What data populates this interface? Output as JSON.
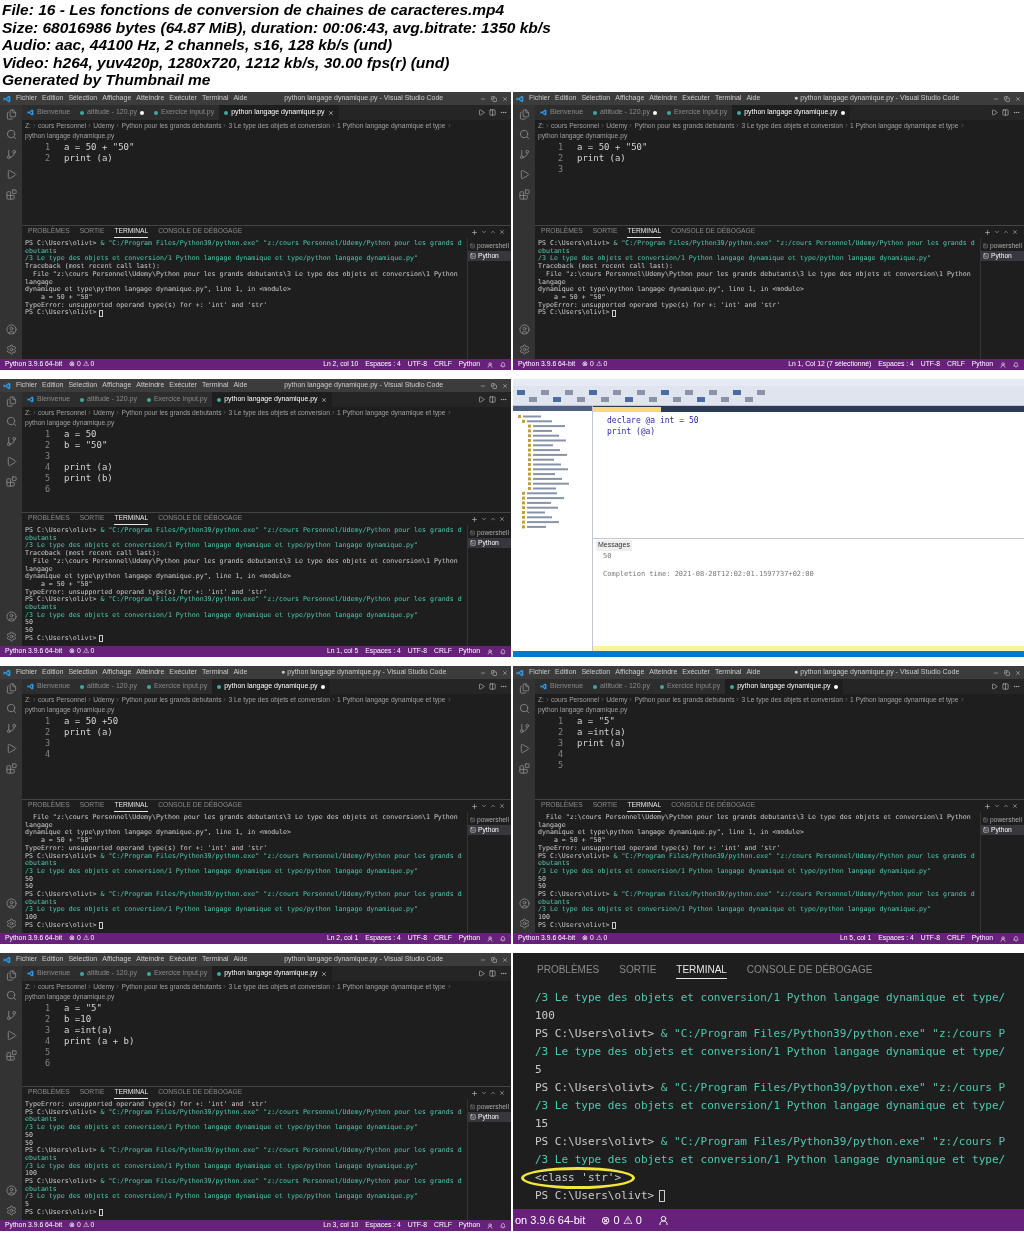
{
  "header": [
    "File: 16 - Les fonctions de conversion de chaines de caracteres.mp4",
    "Size: 68016986 bytes (64.87 MiB), duration: 00:06:43, avg.bitrate: 1350 kb/s",
    "Audio: aac, 44100 Hz, 2 channels, s16, 128 kb/s (und)",
    "Video: h264, yuv420p, 1280x720, 1212 kb/s, 30.00 fps(r) (und)",
    "Generated by Thumbnail me"
  ],
  "tiles": [
    {
      "kind": "vscode",
      "title": "python langage dynamique.py - Visual Studio Code",
      "menu": [
        "Fichier",
        "Edition",
        "Sélection",
        "Affichage",
        "Atteindre",
        "Exécuter",
        "Terminal",
        "Aide"
      ],
      "tabs": [
        {
          "kind": "welcome",
          "label": "Bienvenue",
          "selected": false,
          "modified": false
        },
        {
          "kind": "python",
          "label": "altitude - 120.py",
          "selected": false,
          "modified": true
        },
        {
          "kind": "python",
          "label": "Exercice input.py",
          "selected": false,
          "modified": false
        },
        {
          "kind": "python",
          "label": "python langage dynamique.py",
          "selected": true,
          "modified": false
        }
      ],
      "breadcrumb": [
        "Z:",
        "cours Personnel",
        "Udemy",
        "Python pour les grands debutants",
        "3 Le type des objets et conversion",
        "1 Python langage dynamique et type",
        "python langage dynamique.py"
      ],
      "code": [
        {
          "number": "1",
          "text": "a = 50 + \"50\""
        },
        {
          "number": "2",
          "text": "print (a)"
        }
      ],
      "panel_tabs": [
        {
          "label": "PROBLÈMES",
          "selected": false
        },
        {
          "label": "SORTIE",
          "selected": false
        },
        {
          "label": "TERMINAL",
          "selected": true
        },
        {
          "label": "CONSOLE DE DÉBOGAGE",
          "selected": false
        }
      ],
      "terminal": [
        {
          "kind": "command",
          "prompt": "PS C:\\Users\\olivt>",
          "text": "& \"C:/Program Files/Python39/python.exe\" \"z:/cours Personnel/Udemy/Python pour les grands debutants"
        },
        {
          "kind": "continuation",
          "text": "/3 Le type des objets et conversion/1 Python langage dynamique et type/python langage dynamique.py\""
        },
        {
          "kind": "output",
          "text": "Traceback (most recent call last):"
        },
        {
          "kind": "output",
          "text": "  File \"z:\\cours Personnel\\Udemy\\Python pour les grands debutants\\3 Le type des objets et conversion\\1 Python langage"
        },
        {
          "kind": "output",
          "text": "dynamique et type\\python langage dynamique.py\", line 1, in <module>"
        },
        {
          "kind": "output",
          "text": "    a = 50 + \"50\""
        },
        {
          "kind": "output",
          "text": "TypeError: unsupported operand type(s) for +: 'int' and 'str'"
        },
        {
          "kind": "prompt",
          "prompt": "PS C:\\Users\\olivt>"
        }
      ],
      "terminals": [
        {
          "label": "powershell",
          "selected": false
        },
        {
          "label": "Python",
          "selected": true
        }
      ],
      "status_left": [
        "Python 3.9.6 64-bit",
        "⊗ 0 ⚠ 0"
      ],
      "status_right": [
        "Ln 2, col 10",
        "Espaces : 4",
        "UTF-8",
        "CRLF",
        "Python"
      ]
    },
    {
      "kind": "vscode",
      "title": "● python langage dynamique.py - Visual Studio Code",
      "menu": [
        "Fichier",
        "Edition",
        "Sélection",
        "Affichage",
        "Atteindre",
        "Exécuter",
        "Terminal",
        "Aide"
      ],
      "tabs": [
        {
          "kind": "welcome",
          "label": "Bienvenue",
          "selected": false,
          "modified": false
        },
        {
          "kind": "python",
          "label": "altitude - 120.py",
          "selected": false,
          "modified": true
        },
        {
          "kind": "python",
          "label": "Exercice input.py",
          "selected": false,
          "modified": false
        },
        {
          "kind": "python",
          "label": "python langage dynamique.py",
          "selected": true,
          "modified": true
        }
      ],
      "breadcrumb": [
        "Z:",
        "cours Personnel",
        "Udemy",
        "Python pour les grands debutants",
        "3 Le type des objets et conversion",
        "1 Python langage dynamique et type",
        "python langage dynamique.py"
      ],
      "code": [
        {
          "number": "1",
          "text": "a = 50 + \"50\""
        },
        {
          "number": "2",
          "text": "print (a)"
        },
        {
          "number": "3"
        }
      ],
      "panel_tabs": [
        {
          "label": "PROBLÈMES",
          "selected": false
        },
        {
          "label": "SORTIE",
          "selected": false
        },
        {
          "label": "TERMINAL",
          "selected": true
        },
        {
          "label": "CONSOLE DE DÉBOGAGE",
          "selected": false
        }
      ],
      "terminal": [
        {
          "kind": "command",
          "prompt": "PS C:\\Users\\olivt>",
          "text": "& \"C:/Program Files/Python39/python.exe\" \"z:/cours Personnel/Udemy/Python pour les grands debutants"
        },
        {
          "kind": "continuation",
          "text": "/3 Le type des objets et conversion/1 Python langage dynamique et type/python langage dynamique.py\""
        },
        {
          "kind": "output",
          "text": "Traceback (most recent call last):"
        },
        {
          "kind": "output",
          "text": "  File \"z:\\cours Personnel\\Udemy\\Python pour les grands debutants\\3 Le type des objets et conversion\\1 Python langage"
        },
        {
          "kind": "output",
          "text": "dynamique et type\\python langage dynamique.py\", line 1, in <module>"
        },
        {
          "kind": "output",
          "text": "    a = 50 + \"50\""
        },
        {
          "kind": "output",
          "text": "TypeError: unsupported operand type(s) for +: 'int' and 'str'"
        },
        {
          "kind": "prompt",
          "prompt": "PS C:\\Users\\olivt>"
        }
      ],
      "terminals": [
        {
          "label": "powershell",
          "selected": false
        },
        {
          "label": "Python",
          "selected": true
        }
      ],
      "status_left": [
        "Python 3.9.6 64-bit",
        "⊗ 0 ⚠ 0"
      ],
      "status_right": [
        "Ln 1, Col 12 (7 sélectionné)",
        "Espaces : 4",
        "UTF-8",
        "CRLF",
        "Python"
      ]
    },
    {
      "kind": "vscode",
      "title": "python langage dynamique.py - Visual Studio Code",
      "menu": [
        "Fichier",
        "Edition",
        "Sélection",
        "Affichage",
        "Atteindre",
        "Exécuter",
        "Terminal",
        "Aide"
      ],
      "tabs": [
        {
          "kind": "welcome",
          "label": "Bienvenue",
          "selected": false,
          "modified": false
        },
        {
          "kind": "python",
          "label": "altitude - 120.py",
          "selected": false,
          "modified": false
        },
        {
          "kind": "python",
          "label": "Exercice input.py",
          "selected": false,
          "modified": false
        },
        {
          "kind": "python",
          "label": "python langage dynamique.py",
          "selected": true,
          "modified": false
        }
      ],
      "breadcrumb": [
        "Z:",
        "cours Personnel",
        "Udemy",
        "Python pour les grands debutants",
        "3 Le type des objets et conversion",
        "1 Python langage dynamique et type",
        "python langage dynamique.py"
      ],
      "code": [
        {
          "number": "1",
          "text": "a = 50"
        },
        {
          "number": "2",
          "text": "b = \"50\""
        },
        {
          "number": "3"
        },
        {
          "number": "4",
          "text": "print (a)"
        },
        {
          "number": "5",
          "text": "print (b)"
        },
        {
          "number": "6"
        }
      ],
      "panel_tabs": [
        {
          "label": "PROBLÈMES",
          "selected": false
        },
        {
          "label": "SORTIE",
          "selected": false
        },
        {
          "label": "TERMINAL",
          "selected": true
        },
        {
          "label": "CONSOLE DE DÉBOGAGE",
          "selected": false
        }
      ],
      "terminal": [
        {
          "kind": "command",
          "prompt": "PS C:\\Users\\olivt>",
          "text": "& \"C:/Program Files/Python39/python.exe\" \"z:/cours Personnel/Udemy/Python pour les grands debutants"
        },
        {
          "kind": "continuation",
          "text": "/3 Le type des objets et conversion/1 Python langage dynamique et type/python langage dynamique.py\""
        },
        {
          "kind": "output",
          "text": "Traceback (most recent call last):"
        },
        {
          "kind": "output",
          "text": "  File \"z:\\cours Personnel\\Udemy\\Python pour les grands debutants\\3 Le type des objets et conversion\\1 Python langage"
        },
        {
          "kind": "output",
          "text": "dynamique et type\\python langage dynamique.py\", line 1, in <module>"
        },
        {
          "kind": "output",
          "text": "    a = 50 + \"50\""
        },
        {
          "kind": "output",
          "text": "TypeError: unsupported operand type(s) for +: 'int' and 'str'"
        },
        {
          "kind": "command",
          "prompt": "PS C:\\Users\\olivt>",
          "text": "& \"C:/Program Files/Python39/python.exe\" \"z:/cours Personnel/Udemy/Python pour les grands debutants"
        },
        {
          "kind": "continuation",
          "text": "/3 Le type des objets et conversion/1 Python langage dynamique et type/python langage dynamique.py\""
        },
        {
          "kind": "output",
          "text": "50"
        },
        {
          "kind": "output",
          "text": "50"
        },
        {
          "kind": "prompt",
          "prompt": "PS C:\\Users\\olivt>"
        }
      ],
      "terminals": [
        {
          "label": "powershell",
          "selected": false
        },
        {
          "label": "Python",
          "selected": true
        }
      ],
      "status_left": [
        "Python 3.9.6 64-bit",
        "⊗ 0 ⚠ 0"
      ],
      "status_right": [
        "Ln 1, col 5",
        "Espaces : 4",
        "UTF-8",
        "CRLF",
        "Python"
      ]
    },
    {
      "kind": "ssms",
      "code": [
        "declare @a int = 50",
        "print (@a)"
      ],
      "messages_tab": "Messages",
      "messages": [
        "50",
        "Completion time: 2021-08-28T12:02:01.1597737+02:00"
      ]
    },
    {
      "kind": "vscode",
      "title": "● python langage dynamique.py - Visual Studio Code",
      "menu": [
        "Fichier",
        "Edition",
        "Sélection",
        "Affichage",
        "Atteindre",
        "Exécuter",
        "Terminal",
        "Aide"
      ],
      "tabs": [
        {
          "kind": "welcome",
          "label": "Bienvenue",
          "selected": false,
          "modified": false
        },
        {
          "kind": "python",
          "label": "altitude - 120.py",
          "selected": false,
          "modified": false
        },
        {
          "kind": "python",
          "label": "Exercice input.py",
          "selected": false,
          "modified": false
        },
        {
          "kind": "python",
          "label": "python langage dynamique.py",
          "selected": true,
          "modified": true
        }
      ],
      "breadcrumb": [
        "Z:",
        "cours Personnel",
        "Udemy",
        "Python pour les grands debutants",
        "3 Le type des objets et conversion",
        "1 Python langage dynamique et type",
        "python langage dynamique.py"
      ],
      "code": [
        {
          "number": "1",
          "text": "a = 50 +50"
        },
        {
          "number": "2",
          "text": "print (a)"
        },
        {
          "number": "3"
        },
        {
          "number": "4"
        }
      ],
      "panel_tabs": [
        {
          "label": "PROBLÈMES",
          "selected": false
        },
        {
          "label": "SORTIE",
          "selected": false
        },
        {
          "label": "TERMINAL",
          "selected": true
        },
        {
          "label": "CONSOLE DE DÉBOGAGE",
          "selected": false
        }
      ],
      "terminal": [
        {
          "kind": "output",
          "text": "  File \"z:\\cours Personnel\\Udemy\\Python pour les grands debutants\\3 Le type des objets et conversion\\1 Python langage"
        },
        {
          "kind": "output",
          "text": "dynamique et type\\python langage dynamique.py\", line 1, in <module>"
        },
        {
          "kind": "output",
          "text": "    a = 50 + \"50\""
        },
        {
          "kind": "output",
          "text": "TypeError: unsupported operand type(s) for +: 'int' and 'str'"
        },
        {
          "kind": "command",
          "prompt": "PS C:\\Users\\olivt>",
          "text": "& \"C:/Program Files/Python39/python.exe\" \"z:/cours Personnel/Udemy/Python pour les grands debutants"
        },
        {
          "kind": "continuation",
          "text": "/3 Le type des objets et conversion/1 Python langage dynamique et type/python langage dynamique.py\""
        },
        {
          "kind": "output",
          "text": "50"
        },
        {
          "kind": "output",
          "text": "50"
        },
        {
          "kind": "command",
          "prompt": "PS C:\\Users\\olivt>",
          "text": "& \"C:/Program Files/Python39/python.exe\" \"z:/cours Personnel/Udemy/Python pour les grands debutants"
        },
        {
          "kind": "continuation",
          "text": "/3 Le type des objets et conversion/1 Python langage dynamique et type/python langage dynamique.py\""
        },
        {
          "kind": "output",
          "text": "100"
        },
        {
          "kind": "prompt",
          "prompt": "PS C:\\Users\\olivt>"
        }
      ],
      "terminals": [
        {
          "label": "powershell",
          "selected": false
        },
        {
          "label": "Python",
          "selected": true
        }
      ],
      "status_left": [
        "Python 3.9.6 64-bit",
        "⊗ 0 ⚠ 0"
      ],
      "status_right": [
        "Ln 2, col 1",
        "Espaces : 4",
        "UTF-8",
        "CRLF",
        "Python"
      ]
    },
    {
      "kind": "vscode",
      "title": "● python langage dynamique.py - Visual Studio Code",
      "menu": [
        "Fichier",
        "Edition",
        "Sélection",
        "Affichage",
        "Atteindre",
        "Exécuter",
        "Terminal",
        "Aide"
      ],
      "tabs": [
        {
          "kind": "welcome",
          "label": "Bienvenue",
          "selected": false,
          "modified": false
        },
        {
          "kind": "python",
          "label": "altitude - 120.py",
          "selected": false,
          "modified": false
        },
        {
          "kind": "python",
          "label": "Exercice input.py",
          "selected": false,
          "modified": false
        },
        {
          "kind": "python",
          "label": "python langage dynamique.py",
          "selected": true,
          "modified": true
        }
      ],
      "breadcrumb": [
        "Z:",
        "cours Personnel",
        "Udemy",
        "Python pour les grands debutants",
        "3 Le type des objets et conversion",
        "1 Python langage dynamique et type",
        "python langage dynamique.py"
      ],
      "code": [
        {
          "number": "1",
          "text": "a = \"5\""
        },
        {
          "number": "2",
          "text": "a =int(a)"
        },
        {
          "number": "3",
          "text": "print (a)"
        },
        {
          "number": "4"
        },
        {
          "number": "5"
        }
      ],
      "panel_tabs": [
        {
          "label": "PROBLÈMES",
          "selected": false
        },
        {
          "label": "SORTIE",
          "selected": false
        },
        {
          "label": "TERMINAL",
          "selected": true
        },
        {
          "label": "CONSOLE DE DÉBOGAGE",
          "selected": false
        }
      ],
      "terminal": [
        {
          "kind": "output",
          "text": "  File \"z:\\cours Personnel\\Udemy\\Python pour les grands debutants\\3 Le type des objets et conversion\\1 Python langage"
        },
        {
          "kind": "output",
          "text": "dynamique et type\\python langage dynamique.py\", line 1, in <module>"
        },
        {
          "kind": "output",
          "text": "    a = 50 + \"50\""
        },
        {
          "kind": "output",
          "text": "TypeError: unsupported operand type(s) for +: 'int' and 'str'"
        },
        {
          "kind": "command",
          "prompt": "PS C:\\Users\\olivt>",
          "text": "& \"C:/Program Files/Python39/python.exe\" \"z:/cours Personnel/Udemy/Python pour les grands debutants"
        },
        {
          "kind": "continuation",
          "text": "/3 Le type des objets et conversion/1 Python langage dynamique et type/python langage dynamique.py\""
        },
        {
          "kind": "output",
          "text": "50"
        },
        {
          "kind": "output",
          "text": "50"
        },
        {
          "kind": "command",
          "prompt": "PS C:\\Users\\olivt>",
          "text": "& \"C:/Program Files/Python39/python.exe\" \"z:/cours Personnel/Udemy/Python pour les grands debutants"
        },
        {
          "kind": "continuation",
          "text": "/3 Le type des objets et conversion/1 Python langage dynamique et type/python langage dynamique.py\""
        },
        {
          "kind": "output",
          "text": "100"
        },
        {
          "kind": "prompt",
          "prompt": "PS C:\\Users\\olivt>"
        }
      ],
      "terminals": [
        {
          "label": "powershell",
          "selected": false
        },
        {
          "label": "Python",
          "selected": true
        }
      ],
      "status_left": [
        "Python 3.9.6 64-bit",
        "⊗ 0 ⚠ 0"
      ],
      "status_right": [
        "Ln 5, col 1",
        "Espaces : 4",
        "UTF-8",
        "CRLF",
        "Python"
      ]
    },
    {
      "kind": "vscode",
      "title": "python langage dynamique.py - Visual Studio Code",
      "menu": [
        "Fichier",
        "Edition",
        "Sélection",
        "Affichage",
        "Atteindre",
        "Exécuter",
        "Terminal",
        "Aide"
      ],
      "tabs": [
        {
          "kind": "welcome",
          "label": "Bienvenue",
          "selected": false,
          "modified": false
        },
        {
          "kind": "python",
          "label": "altitude - 120.py",
          "selected": false,
          "modified": false
        },
        {
          "kind": "python",
          "label": "Exercice input.py",
          "selected": false,
          "modified": false
        },
        {
          "kind": "python",
          "label": "python langage dynamique.py",
          "selected": true,
          "modified": false
        }
      ],
      "breadcrumb": [
        "Z:",
        "cours Personnel",
        "Udemy",
        "Python pour les grands debutants",
        "3 Le type des objets et conversion",
        "1 Python langage dynamique et type",
        "python langage dynamique.py"
      ],
      "code": [
        {
          "number": "1",
          "text": "a = \"5\""
        },
        {
          "number": "2",
          "text": "b =10"
        },
        {
          "number": "3",
          "text": "a =int(a)"
        },
        {
          "number": "4",
          "text": "print (a + b)"
        },
        {
          "number": "5"
        },
        {
          "number": "6"
        }
      ],
      "panel_tabs": [
        {
          "label": "PROBLÈMES",
          "selected": false
        },
        {
          "label": "SORTIE",
          "selected": false
        },
        {
          "label": "TERMINAL",
          "selected": true
        },
        {
          "label": "CONSOLE DE DÉBOGAGE",
          "selected": false
        }
      ],
      "terminal": [
        {
          "kind": "output",
          "text": "TypeError: unsupported operand type(s) for +: 'int' and 'str'"
        },
        {
          "kind": "command",
          "prompt": "PS C:\\Users\\olivt>",
          "text": "& \"C:/Program Files/Python39/python.exe\" \"z:/cours Personnel/Udemy/Python pour les grands debutants"
        },
        {
          "kind": "continuation",
          "text": "/3 Le type des objets et conversion/1 Python langage dynamique et type/python langage dynamique.py\""
        },
        {
          "kind": "output",
          "text": "50"
        },
        {
          "kind": "output",
          "text": "50"
        },
        {
          "kind": "command",
          "prompt": "PS C:\\Users\\olivt>",
          "text": "& \"C:/Program Files/Python39/python.exe\" \"z:/cours Personnel/Udemy/Python pour les grands debutants"
        },
        {
          "kind": "continuation",
          "text": "/3 Le type des objets et conversion/1 Python langage dynamique et type/python langage dynamique.py\""
        },
        {
          "kind": "output",
          "text": "100"
        },
        {
          "kind": "command",
          "prompt": "PS C:\\Users\\olivt>",
          "text": "& \"C:/Program Files/Python39/python.exe\" \"z:/cours Personnel/Udemy/Python pour les grands debutants"
        },
        {
          "kind": "continuation",
          "text": "/3 Le type des objets et conversion/1 Python langage dynamique et type/python langage dynamique.py\""
        },
        {
          "kind": "output",
          "text": "5"
        },
        {
          "kind": "prompt",
          "prompt": "PS C:\\Users\\olivt>"
        }
      ],
      "terminals": [
        {
          "label": "powershell",
          "selected": false
        },
        {
          "label": "Python",
          "selected": true
        }
      ],
      "status_left": [
        "Python 3.9.6 64-bit",
        "⊗ 0 ⚠ 0"
      ],
      "status_right": [
        "Ln 3, col 10",
        "Espaces : 4",
        "UTF-8",
        "CRLF",
        "Python"
      ]
    },
    {
      "kind": "terminal_zoom",
      "panel_tabs": [
        {
          "label": "PROBLÈMES",
          "selected": false
        },
        {
          "label": "SORTIE",
          "selected": false
        },
        {
          "label": "TERMINAL",
          "selected": true
        },
        {
          "label": "CONSOLE DE DÉBOGAGE",
          "selected": false
        }
      ],
      "terminal": [
        {
          "kind": "continuation",
          "text": "/3 Le type des objets et conversion/1 Python langage dynamique et type/",
          "circled": false
        },
        {
          "kind": "output",
          "text": "100",
          "circled": false
        },
        {
          "kind": "command",
          "prompt": "PS C:\\Users\\olivt>",
          "text": "& \"C:/Program Files/Python39/python.exe\" \"z:/cours P",
          "circled": false
        },
        {
          "kind": "continuation",
          "text": "/3 Le type des objets et conversion/1 Python langage dynamique et type/",
          "circled": false
        },
        {
          "kind": "output",
          "text": "5",
          "circled": false
        },
        {
          "kind": "command",
          "prompt": "PS C:\\Users\\olivt>",
          "text": "& \"C:/Program Files/Python39/python.exe\" \"z:/cours P",
          "circled": false
        },
        {
          "kind": "continuation",
          "text": "/3 Le type des objets et conversion/1 Python langage dynamique et type/",
          "circled": false
        },
        {
          "kind": "output",
          "text": "15",
          "circled": false
        },
        {
          "kind": "command",
          "prompt": "PS C:\\Users\\olivt>",
          "text": "& \"C:/Program Files/Python39/python.exe\" \"z:/cours P",
          "circled": false
        },
        {
          "kind": "continuation",
          "text": "/3 Le type des objets et conversion/1 Python langage dynamique et type/",
          "circled": false
        },
        {
          "kind": "output",
          "text": "<class 'str'>",
          "circled": true
        },
        {
          "kind": "prompt",
          "prompt": "PS C:\\Users\\olivt>",
          "circled": false
        }
      ],
      "status_left": [
        "on 3.9.6 64-bit",
        "⊗ 0 ⚠ 0"
      ]
    }
  ]
}
